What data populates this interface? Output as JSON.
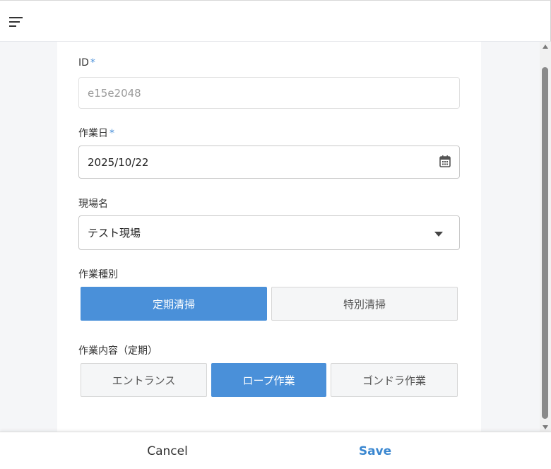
{
  "form": {
    "id_label": "ID",
    "id_required_mark": "*",
    "id_value": "e15e2048",
    "date_label": "作業日",
    "date_required_mark": "*",
    "date_value": "2025/10/22",
    "site_label": "現場名",
    "site_value": "テスト現場",
    "work_type_label": "作業種別",
    "work_type_options": [
      "定期清掃",
      "特別清掃"
    ],
    "work_type_selected": "定期清掃",
    "work_content_label": "作業内容（定期）",
    "work_content_options": [
      "エントランス",
      "ロープ作業",
      "ゴンドラ作業"
    ],
    "work_content_selected": "ロープ作業"
  },
  "footer": {
    "cancel_label": "Cancel",
    "save_label": "Save"
  },
  "icons": {
    "menu": "menu-icon",
    "date": "calendar-icon",
    "dropdown": "caret-down-icon"
  },
  "colors": {
    "accent": "#4a90d9",
    "save_text": "#3a87d0",
    "background": "#f5f6f8"
  }
}
